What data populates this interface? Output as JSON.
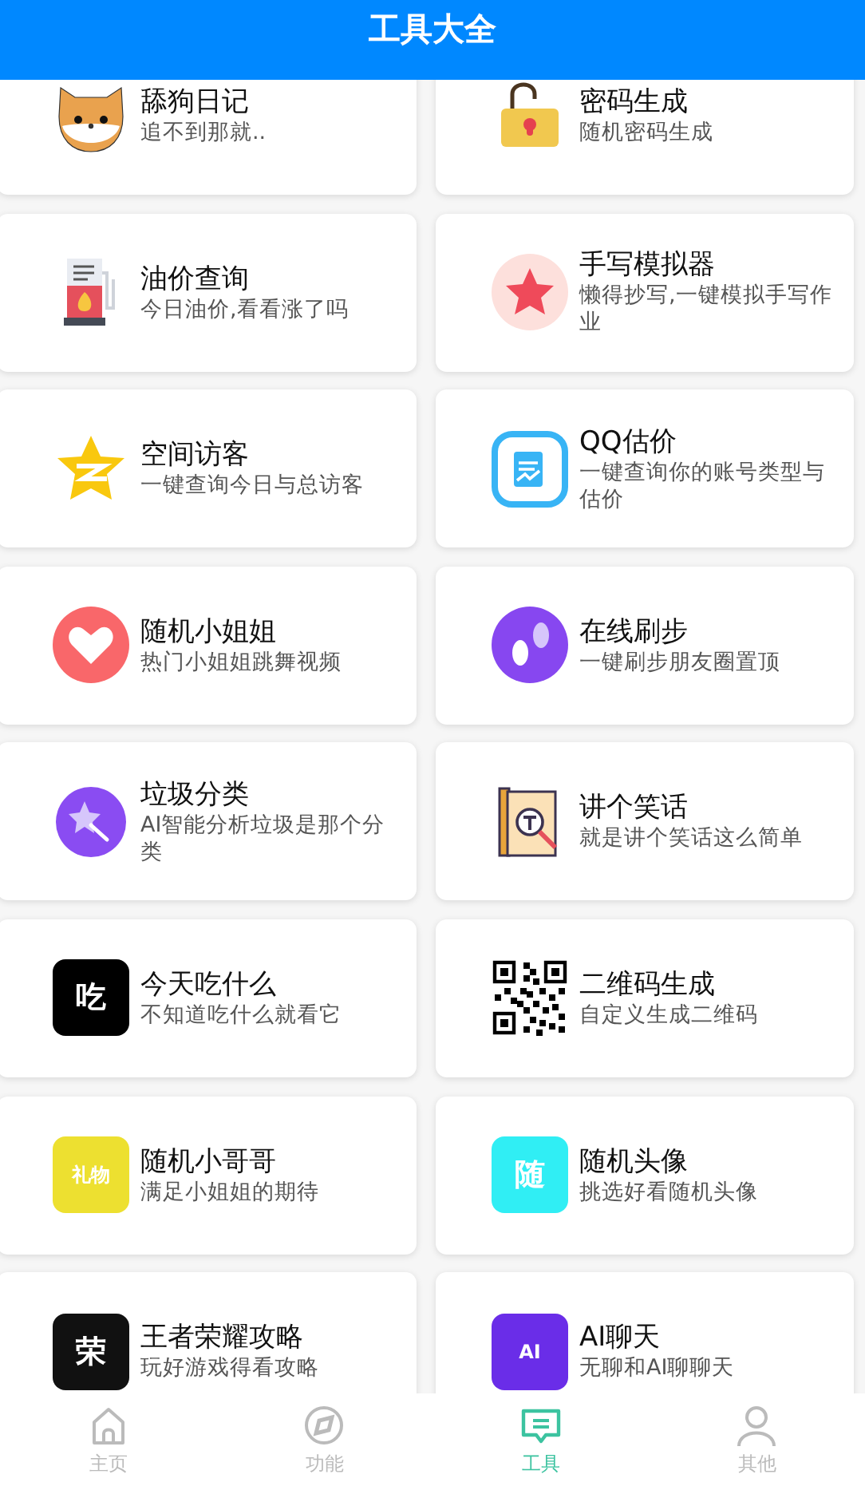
{
  "header": {
    "title": "工具大全"
  },
  "tools": [
    {
      "title": "舔狗日记",
      "subtitle": "追不到那就..",
      "icon": {
        "kind": "dog"
      }
    },
    {
      "title": "密码生成",
      "subtitle": "随机密码生成",
      "icon": {
        "kind": "lock"
      }
    },
    {
      "title": "油价查询",
      "subtitle": "今日油价,看看涨了吗",
      "icon": {
        "kind": "fuel"
      }
    },
    {
      "title": "手写模拟器",
      "subtitle": "懒得抄写,一键模拟手写作业",
      "icon": {
        "kind": "star"
      }
    },
    {
      "title": "空间访客",
      "subtitle": "一键查询今日与总访客",
      "icon": {
        "kind": "zstar"
      }
    },
    {
      "title": "QQ估价",
      "subtitle": "一键查询你的账号类型与估价",
      "icon": {
        "kind": "report"
      }
    },
    {
      "title": "随机小姐姐",
      "subtitle": "热门小姐姐跳舞视频",
      "icon": {
        "kind": "heart"
      }
    },
    {
      "title": "在线刷步",
      "subtitle": "一键刷步朋友圈置顶",
      "icon": {
        "kind": "feet"
      }
    },
    {
      "title": "垃圾分类",
      "subtitle": "AI智能分析垃圾是那个分类",
      "icon": {
        "kind": "wand"
      }
    },
    {
      "title": "讲个笑话",
      "subtitle": "就是讲个笑话这么简单",
      "icon": {
        "kind": "book"
      }
    },
    {
      "title": "今天吃什么",
      "subtitle": "不知道吃什么就看它",
      "icon": {
        "kind": "tile",
        "text": "吃",
        "color": "#000000"
      }
    },
    {
      "title": "二维码生成",
      "subtitle": "自定义生成二维码",
      "icon": {
        "kind": "qr"
      }
    },
    {
      "title": "随机小哥哥",
      "subtitle": "满足小姐姐的期待",
      "icon": {
        "kind": "tile",
        "text": "礼物",
        "color": "#ede030"
      }
    },
    {
      "title": "随机头像",
      "subtitle": "挑选好看随机头像",
      "icon": {
        "kind": "tile",
        "text": "随",
        "color": "#30eef4"
      }
    },
    {
      "title": "王者荣耀攻略",
      "subtitle": "玩好游戏得看攻略",
      "icon": {
        "kind": "tile",
        "text": "荣",
        "color": "#111111"
      }
    },
    {
      "title": "AI聊天",
      "subtitle": "无聊和AI聊聊天",
      "icon": {
        "kind": "tile",
        "text": "AI",
        "color": "#6a2de8"
      }
    }
  ],
  "tab_bar": [
    {
      "label": "主页",
      "selected": false
    },
    {
      "label": "功能",
      "selected": false
    },
    {
      "label": "工具",
      "selected": true
    },
    {
      "label": "其他",
      "selected": false
    }
  ]
}
